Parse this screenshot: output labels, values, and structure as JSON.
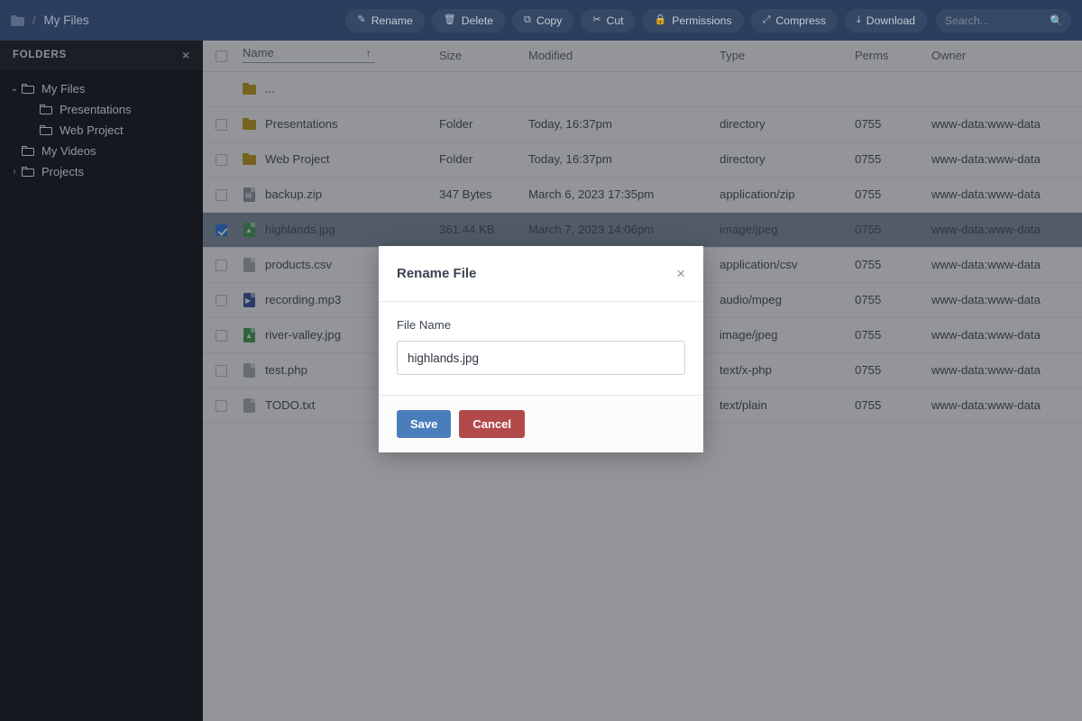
{
  "header": {
    "breadcrumb_icon": "folder-icon",
    "breadcrumb_separator": "/",
    "breadcrumb_label": "My Files",
    "toolbar": [
      {
        "id": "rename",
        "label": "Rename",
        "icon": "pencil-icon",
        "glyph": "✎"
      },
      {
        "id": "delete",
        "label": "Delete",
        "icon": "trash-icon",
        "glyph": "🗑"
      },
      {
        "id": "copy",
        "label": "Copy",
        "icon": "copy-icon",
        "glyph": "⧉"
      },
      {
        "id": "cut",
        "label": "Cut",
        "icon": "scissors-icon",
        "glyph": "✂"
      },
      {
        "id": "permissions",
        "label": "Permissions",
        "icon": "lock-icon",
        "glyph": "🔒"
      },
      {
        "id": "compress",
        "label": "Compress",
        "icon": "compress-icon",
        "glyph": "⤢"
      },
      {
        "id": "download",
        "label": "Download",
        "icon": "download-icon",
        "glyph": "⤓"
      }
    ],
    "search": {
      "value": "",
      "placeholder": "Search...",
      "icon": "search-icon",
      "glyph": "🔍"
    }
  },
  "sidebar": {
    "title": "FOLDERS",
    "close_icon": "close-icon",
    "close_glyph": "×",
    "tree": [
      {
        "label": "My Files",
        "depth": 0,
        "caret": "⌄",
        "expanded": true
      },
      {
        "label": "Presentations",
        "depth": 1,
        "caret": "",
        "expanded": false
      },
      {
        "label": "Web Project",
        "depth": 1,
        "caret": "",
        "expanded": false
      },
      {
        "label": "My Videos",
        "depth": 0,
        "caret": "",
        "expanded": false
      },
      {
        "label": "Projects",
        "depth": 0,
        "caret": "›",
        "expanded": false
      }
    ]
  },
  "table": {
    "columns": [
      "Name",
      "Size",
      "Modified",
      "Type",
      "Perms",
      "Owner"
    ],
    "sort_column": "Name",
    "sort_arrow": "↑",
    "select_all_checked": false,
    "rows": [
      {
        "name": "...",
        "size": "",
        "modified": "",
        "type": "",
        "perms": "",
        "owner": "",
        "icon": "folder-icon",
        "kind": "parent",
        "selected": false,
        "checked": false
      },
      {
        "name": "Presentations",
        "size": "Folder",
        "modified": "Today, 16:37pm",
        "type": "directory",
        "perms": "0755",
        "owner": "www-data:www-data",
        "icon": "folder-icon",
        "kind": "folder",
        "selected": false,
        "checked": false
      },
      {
        "name": "Web Project",
        "size": "Folder",
        "modified": "Today, 16:37pm",
        "type": "directory",
        "perms": "0755",
        "owner": "www-data:www-data",
        "icon": "folder-icon",
        "kind": "folder",
        "selected": false,
        "checked": false
      },
      {
        "name": "backup.zip",
        "size": "347 Bytes",
        "modified": "March 6, 2023 17:35pm",
        "type": "application/zip",
        "perms": "0755",
        "owner": "www-data:www-data",
        "icon": "archive-file-icon",
        "kind": "archive",
        "selected": false,
        "checked": false
      },
      {
        "name": "highlands.jpg",
        "size": "361.44 KB",
        "modified": "March 7, 2023 14:06pm",
        "type": "image/jpeg",
        "perms": "0755",
        "owner": "www-data:www-data",
        "icon": "image-file-icon",
        "kind": "image",
        "selected": true,
        "checked": true
      },
      {
        "name": "products.csv",
        "size": "",
        "modified": "",
        "type": "application/csv",
        "perms": "0755",
        "owner": "www-data:www-data",
        "icon": "text-file-icon",
        "kind": "text",
        "selected": false,
        "checked": false
      },
      {
        "name": "recording.mp3",
        "size": "",
        "modified": "",
        "type": "audio/mpeg",
        "perms": "0755",
        "owner": "www-data:www-data",
        "icon": "audio-file-icon",
        "kind": "audio",
        "selected": false,
        "checked": false
      },
      {
        "name": "river-valley.jpg",
        "size": "",
        "modified": "",
        "type": "image/jpeg",
        "perms": "0755",
        "owner": "www-data:www-data",
        "icon": "image-file-icon",
        "kind": "image",
        "selected": false,
        "checked": false
      },
      {
        "name": "test.php",
        "size": "",
        "modified": "",
        "type": "text/x-php",
        "perms": "0755",
        "owner": "www-data:www-data",
        "icon": "text-file-icon",
        "kind": "text",
        "selected": false,
        "checked": false
      },
      {
        "name": "TODO.txt",
        "size": "",
        "modified": "",
        "type": "text/plain",
        "perms": "0755",
        "owner": "www-data:www-data",
        "icon": "text-file-icon",
        "kind": "text",
        "selected": false,
        "checked": false
      }
    ]
  },
  "modal": {
    "title": "Rename File",
    "close_icon": "close-icon",
    "close_glyph": "×",
    "field_label": "File Name",
    "field_value": "highlands.jpg",
    "field_placeholder": "File Name",
    "save_label": "Save",
    "cancel_label": "Cancel"
  },
  "colors": {
    "topbar": "#2c3e5d",
    "sidebar": "#15181e",
    "selected_row": "#7d8a9c",
    "checkbox_accent": "#1a73e8",
    "folder_icon": "#c49a0d",
    "save_button": "#4a7ebb",
    "cancel_button": "#b34a4a"
  }
}
